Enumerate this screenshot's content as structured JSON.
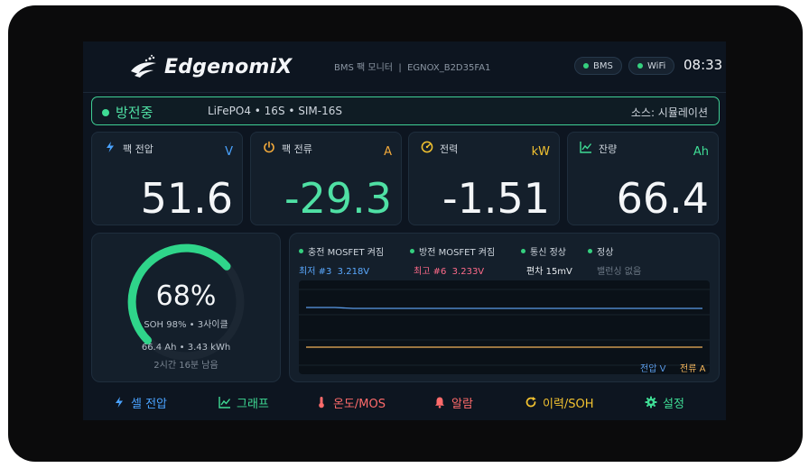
{
  "header": {
    "brand": "EdgenomiX",
    "subtitle": "BMS 팩 모니터  |  EGNOX_B2D35FA1",
    "pills": [
      {
        "label": "BMS"
      },
      {
        "label": "WiFi"
      }
    ],
    "clock": "08:33"
  },
  "status": {
    "state": "방전중",
    "pack": "LiFePO4 • 16S • SIM-16S",
    "source": "소스: 시뮬레이션"
  },
  "cards": [
    {
      "icon": "bolt-icon",
      "label": "팩 전압",
      "unit": "V",
      "value": "51.6",
      "unit_color": "#4aa3ff",
      "value_color": "#f4f6f8"
    },
    {
      "icon": "power-icon",
      "label": "팩 전류",
      "unit": "A",
      "value": "-29.3",
      "unit_color": "#f2a93b",
      "value_color": "#4fe0a4"
    },
    {
      "icon": "gauge-icon",
      "label": "전력",
      "unit": "kW",
      "value": "-1.51",
      "unit_color": "#f2c230",
      "value_color": "#f4f6f8"
    },
    {
      "icon": "chart-icon",
      "label": "잔량",
      "unit": "Ah",
      "value": "66.4",
      "unit_color": "#3fdc95",
      "value_color": "#f4f6f8"
    }
  ],
  "gauge": {
    "percent_label": "68%",
    "level": 0.68,
    "soh": "SOH 98% • 3사이클",
    "capacity": "66.4 Ah • 3.43 kWh",
    "remaining": "2시간 16분 남음",
    "color": "#2fd58a"
  },
  "info": {
    "flags": [
      "충전 MOSFET 켜짐",
      "방전 MOSFET 켜짐",
      "통신 정상",
      "정상"
    ],
    "min_cell": "최저 #3  3.218V",
    "max_cell": "최고 #6  3.233V",
    "delta": "편차 15mV",
    "balance": "밸런싱 없음",
    "legend_voltage": "전압 V",
    "legend_current": "전류 A",
    "voltage_color": "#5a9be8",
    "current_color": "#f2b45a"
  },
  "nav": [
    {
      "icon": "bolt-icon",
      "label": "셀 전압",
      "color": "#4aa3ff"
    },
    {
      "icon": "chart-icon",
      "label": "그래프",
      "color": "#3fdc95"
    },
    {
      "icon": "thermometer-icon",
      "label": "온도/MOS",
      "color": "#ff6b6b"
    },
    {
      "icon": "bell-icon",
      "label": "알람",
      "color": "#ff6b6b"
    },
    {
      "icon": "history-icon",
      "label": "이력/SOH",
      "color": "#f2c230"
    },
    {
      "icon": "gear-icon",
      "label": "설정",
      "color": "#3fdc95"
    }
  ]
}
